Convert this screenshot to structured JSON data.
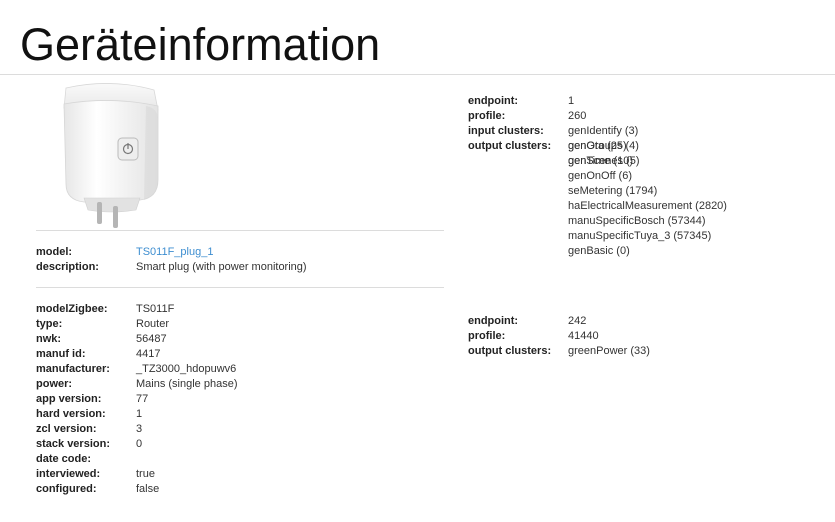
{
  "page": {
    "title": "Geräteinformation"
  },
  "device": {
    "image_alt": "TS011F_plug_1",
    "info1": [
      {
        "label": "model:",
        "value": "TS011F_plug_1",
        "link": true
      },
      {
        "label": "description:",
        "value": "Smart plug (with power monitoring)",
        "link": false
      }
    ],
    "info2": [
      {
        "label": "modelZigbee:",
        "value": "TS011F"
      },
      {
        "label": "type:",
        "value": "Router"
      },
      {
        "label": "nwk:",
        "value": "56487"
      },
      {
        "label": "manuf id:",
        "value": "4417"
      },
      {
        "label": "manufacturer:",
        "value": "_TZ3000_hdopuwv6"
      },
      {
        "label": "power:",
        "value": "Mains (single phase)"
      },
      {
        "label": "app version:",
        "value": "77"
      },
      {
        "label": "hard version:",
        "value": "1"
      },
      {
        "label": "zcl version:",
        "value": "3"
      },
      {
        "label": "stack version:",
        "value": "0"
      },
      {
        "label": "date code:",
        "value": ""
      },
      {
        "label": "interviewed:",
        "value": "true"
      },
      {
        "label": "configured:",
        "value": "false"
      }
    ]
  },
  "endpoints": [
    {
      "endpoint_label": "endpoint:",
      "endpoint": "1",
      "profile_label": "profile:",
      "profile": "260",
      "input_label": "input clusters:",
      "input_clusters": [
        "genIdentify (3)",
        "genGroups (4)",
        "genScenes (5)",
        "genOnOff (6)",
        "seMetering (1794)",
        "haElectricalMeasurement (2820)",
        "manuSpecificBosch (57344)",
        "manuSpecificTuya_3 (57345)",
        "genBasic (0)"
      ],
      "output_label": "output clusters:",
      "output_clusters": [
        "genOta (25)",
        "genTime (10)"
      ]
    },
    {
      "endpoint_label": "endpoint:",
      "endpoint": "242",
      "profile_label": "profile:",
      "profile": "41440",
      "output_label": "output clusters:",
      "output_clusters": [
        "greenPower (33)"
      ]
    }
  ],
  "colors": {
    "link": "#3e8ed0",
    "separator": "#dcdcdc"
  }
}
